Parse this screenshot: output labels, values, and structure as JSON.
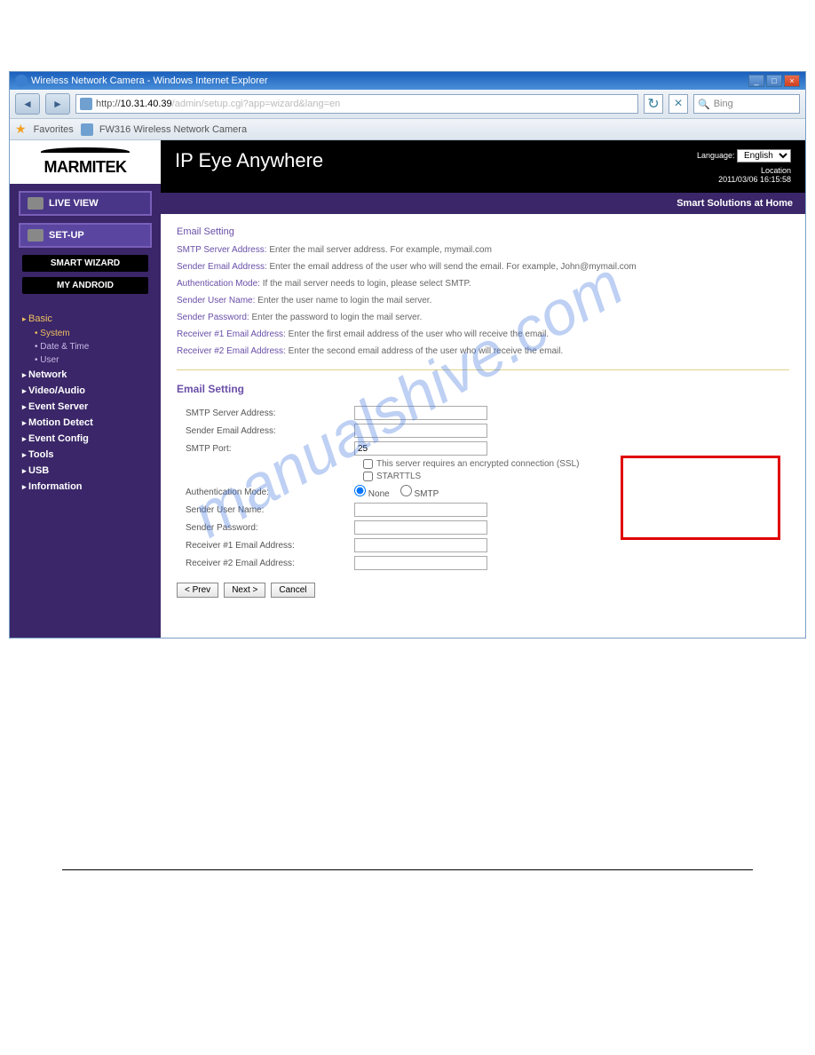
{
  "window": {
    "title": "Wireless Network Camera - Windows Internet Explorer",
    "url_prefix": "http://",
    "url_host": "10.31.40.39",
    "url_path": "/admin/setup.cgi?app=wizard&lang=en",
    "search_placeholder": "Bing",
    "favorites_label": "Favorites",
    "fav_link": "FW316 Wireless Network Camera"
  },
  "brand": "MARMITEK",
  "header": {
    "title": "IP Eye Anywhere",
    "language_label": "Language:",
    "language_value": "English",
    "location_label": "Location",
    "datetime": "2011/03/06 16:15:58",
    "tagline": "Smart Solutions at Home"
  },
  "sidebar": {
    "live_view": "LIVE VIEW",
    "setup": "SET-UP",
    "smart_wizard": "SMART WIZARD",
    "my_android": "MY ANDROID",
    "basic": "Basic",
    "basic_items": [
      "System",
      "Date & Time",
      "User"
    ],
    "items": [
      "Network",
      "Video/Audio",
      "Event Server",
      "Motion Detect",
      "Event Config",
      "Tools",
      "USB",
      "Information"
    ]
  },
  "help": {
    "title": "Email Setting",
    "lines": [
      {
        "label": "SMTP Server Address:",
        "text": "Enter the mail server address. For example, mymail.com"
      },
      {
        "label": "Sender Email Address:",
        "text": "Enter the email address of the user who will send the email. For example, John@mymail.com"
      },
      {
        "label": "Authentication Mode:",
        "text": "If the mail server needs to login, please select SMTP."
      },
      {
        "label": "Sender User Name:",
        "text": "Enter the user name to login the mail server."
      },
      {
        "label": "Sender Password:",
        "text": "Enter the password to login the mail server."
      },
      {
        "label": "Receiver #1 Email Address:",
        "text": "Enter the first email address of the user who will receive the email."
      },
      {
        "label": "Receiver #2 Email Address:",
        "text": "Enter the second email address of the user who will receive the email."
      }
    ]
  },
  "form": {
    "title": "Email Setting",
    "smtp_server_label": "SMTP Server Address:",
    "smtp_server_value": "",
    "sender_email_label": "Sender Email Address:",
    "sender_email_value": "",
    "smtp_port_label": "SMTP Port:",
    "smtp_port_value": "25",
    "ssl_label": "This server requires an encrypted connection (SSL)",
    "starttls_label": "STARTTLS",
    "auth_mode_label": "Authentication Mode:",
    "auth_none": "None",
    "auth_smtp": "SMTP",
    "sender_user_label": "Sender User Name:",
    "sender_user_value": "",
    "sender_pass_label": "Sender Password:",
    "sender_pass_value": "",
    "recv1_label": "Receiver #1 Email Address:",
    "recv1_value": "",
    "recv2_label": "Receiver #2 Email Address:",
    "recv2_value": "",
    "btn_prev": "< Prev",
    "btn_next": "Next >",
    "btn_cancel": "Cancel"
  },
  "watermark": "manualshive.com"
}
